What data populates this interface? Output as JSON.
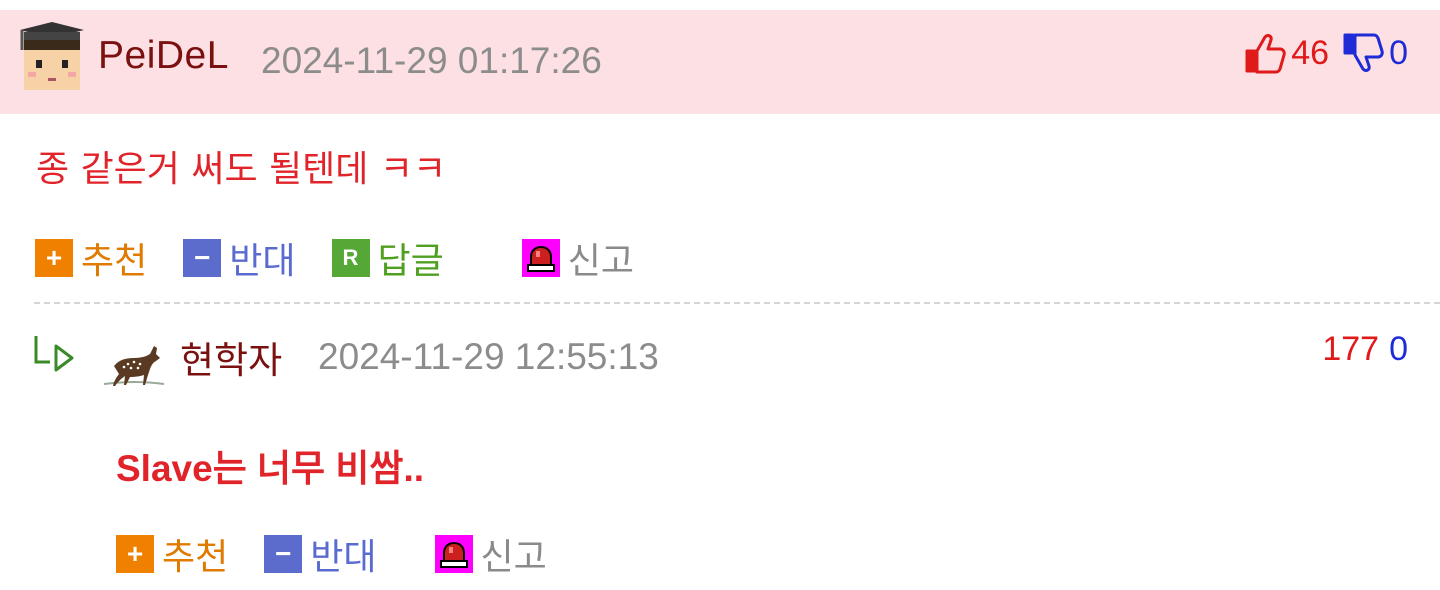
{
  "comments": [
    {
      "nickname": "PeiDeL",
      "datetime": "2024-11-29 01:17:26",
      "body": "종 같은거 써도 될텐데 ㅋㅋ",
      "upvotes": "46",
      "downvotes": "0",
      "avatar_icon": "graduate-avatar-icon",
      "actions": {
        "recommend": "추천",
        "oppose": "반대",
        "reply": "답글",
        "report": "신고",
        "reply_icon_letter": "R"
      }
    },
    {
      "nickname": "현학자",
      "datetime": "2024-11-29 12:55:13",
      "body": "Slave는 너무 비쌈..",
      "upvotes": "177",
      "downvotes": "0",
      "avatar_icon": "deer-avatar-icon",
      "actions": {
        "recommend": "추천",
        "oppose": "반대",
        "report": "신고"
      }
    }
  ],
  "colors": {
    "header_bg": "#fde0e3",
    "nickname": "#7a1010",
    "body_text": "#e0242a",
    "upvote": "#e0191a",
    "downvote": "#1f2bd6",
    "recommend": "#f08000",
    "oppose": "#5b6ccc",
    "reply": "#55a836",
    "report": "#ff00ff"
  }
}
